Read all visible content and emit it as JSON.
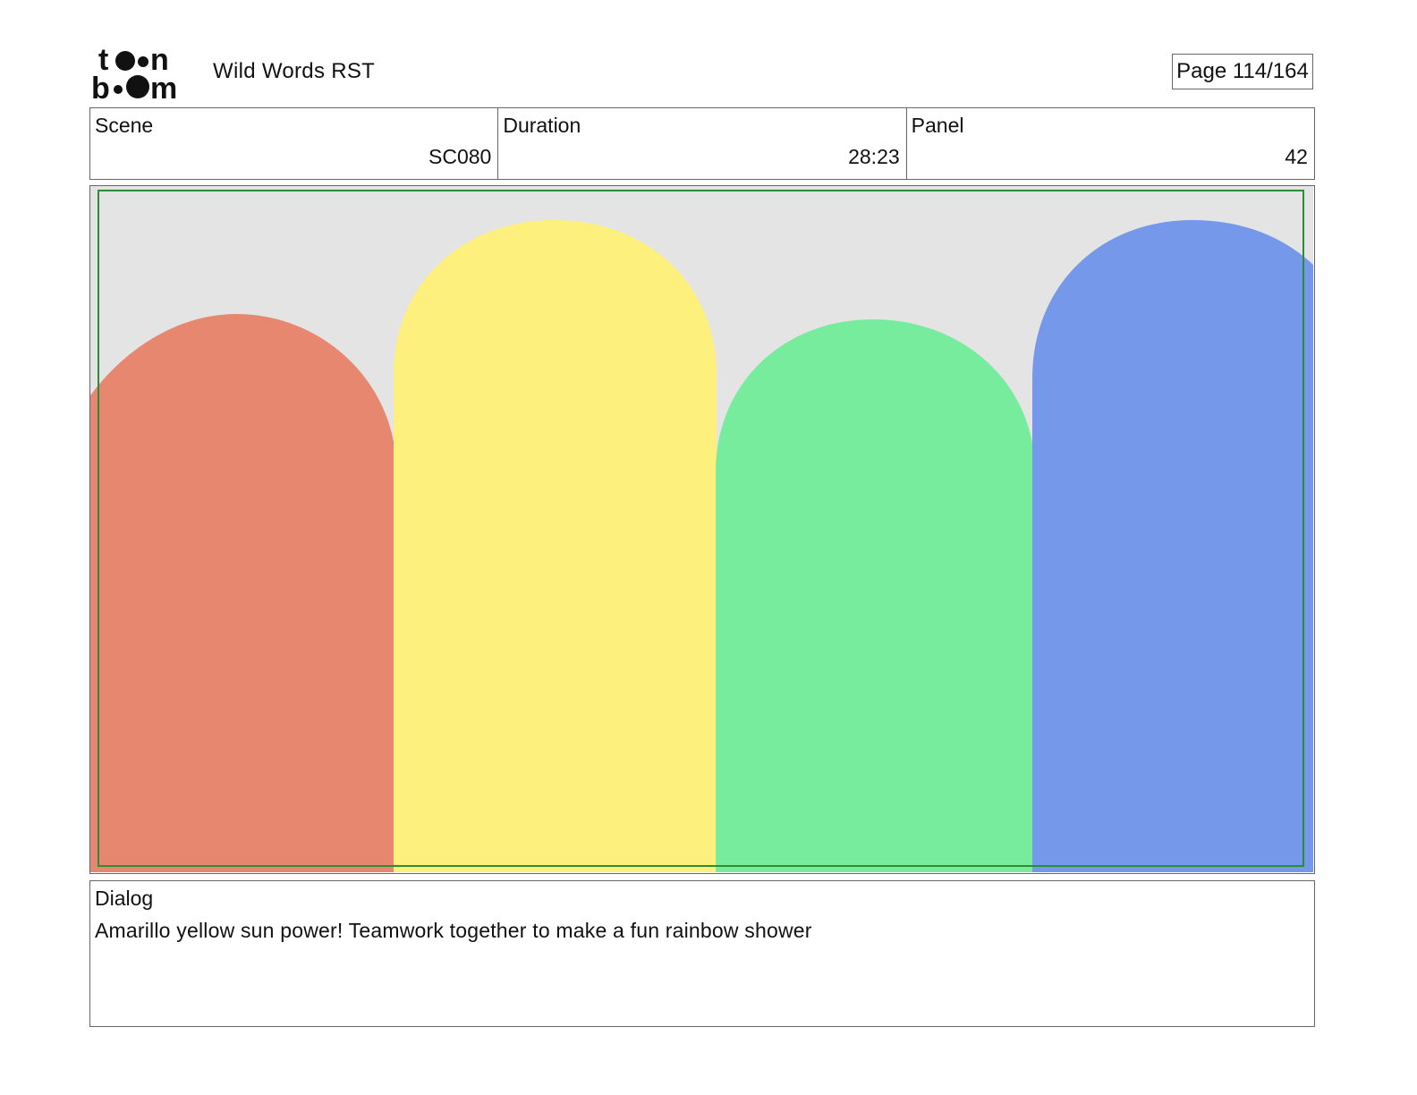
{
  "header": {
    "logo_text_top": "toon",
    "logo_text_bottom": "boom",
    "project_title": "Wild Words RST",
    "page_indicator": "Page 114/164"
  },
  "info": {
    "scene_label": "Scene",
    "scene_value": "SC080",
    "duration_label": "Duration",
    "duration_value": "28:23",
    "panel_label": "Panel",
    "panel_value": "42"
  },
  "panel_image": {
    "background_color": "#e4e4e4",
    "safe_frame_color": "#2e8b3a",
    "shapes": [
      {
        "name": "red",
        "color": "#e8876f"
      },
      {
        "name": "yellow",
        "color": "#fef07c"
      },
      {
        "name": "green",
        "color": "#77ec9c"
      },
      {
        "name": "blue",
        "color": "#7698ea"
      }
    ]
  },
  "dialog": {
    "label": "Dialog",
    "text": "Amarillo yellow sun power! Teamwork together to make a fun rainbow shower"
  }
}
